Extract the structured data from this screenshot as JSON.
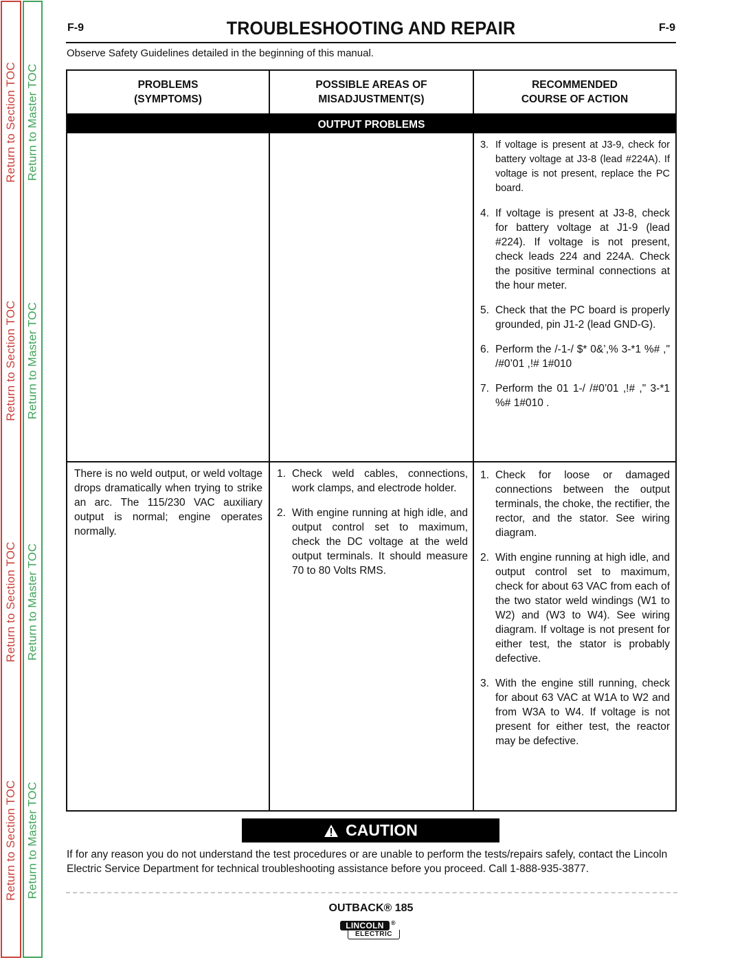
{
  "sidebar": {
    "section_toc_label": "Return to Section TOC",
    "master_toc_label": "Return to Master TOC",
    "colors": {
      "section": "#c8413b",
      "master": "#3fa45b"
    }
  },
  "header": {
    "page_code_left": "F-9",
    "page_code_right": "F-9",
    "title": "TROUBLESHOOTING AND REPAIR",
    "safety_note": "Observe Safety Guidelines detailed in the beginning of this manual."
  },
  "table": {
    "columns": [
      {
        "line1": "PROBLEMS",
        "line2": "(SYMPTOMS)"
      },
      {
        "line1": "POSSIBLE AREAS OF",
        "line2": "MISADJUSTMENT(S)"
      },
      {
        "line1": "RECOMMENDED",
        "line2": "COURSE OF ACTION"
      }
    ],
    "section_band": "OUTPUT PROBLEMS",
    "rows": [
      {
        "symptom": "",
        "misadjustments": [],
        "actions": [
          {
            "num": "3.",
            "text": "If voltage is present at J3-9, check for battery voltage at J3-8 (lead #224A).  If voltage is not present, replace the PC board."
          },
          {
            "num": "4.",
            "text": "If voltage is present at J3-8, check for battery voltage at J1-9 (lead #224).  If voltage is not present, check leads 224 and 224A.  Check the positive terminal connections at the hour meter."
          },
          {
            "num": "5.",
            "text": "Check that the PC board is properly grounded, pin J1-2 (lead GND-G)."
          },
          {
            "num": "6.",
            "text": "Perform the /-1-/ $* 0&’,% 3-*1 %#     ,\"   /#0’01 ,!# 1#010"
          },
          {
            "num": "7.",
            "text": "Perform the 01 1-/ /#0’01 ,!# ,\" 3-*1 %# 1#010 ."
          }
        ]
      },
      {
        "symptom": "There is no weld output, or weld voltage drops dramatically when trying to strike an arc.  The 115/230 VAC auxiliary output is normal;  engine  operates normally.",
        "misadjustments": [
          {
            "num": "1.",
            "text": "Check weld cables, connections, work clamps, and electrode holder."
          },
          {
            "num": "2.",
            "text": "With engine running at high idle, and output control set to maximum, check the DC voltage at the weld output terminals.  It should measure 70 to 80 Volts RMS."
          }
        ],
        "actions": [
          {
            "num": "1.",
            "text": "Check for loose or damaged connections between the output terminals, the choke, the rectifier, the rector, and the stator.  See wiring diagram."
          },
          {
            "num": "2.",
            "text": "With engine running at high idle, and output control set to maximum, check for about 63 VAC from each of the two stator weld windings (W1 to W2) and (W3 to W4).  See wiring diagram.  If voltage is not present for either test, the stator is probably defective."
          },
          {
            "num": "3.",
            "text": "With the engine still running, check for about 63 VAC at W1A to W2 and from W3A to W4.  If voltage is not present for either test, the reactor may be defective."
          }
        ]
      }
    ]
  },
  "caution": {
    "icon": "warning-triangle-icon",
    "label": "CAUTION",
    "text": "If for any reason you do not understand the test procedures or are unable to perform the tests/repairs safely, contact the Lincoln Electric Service Department for technical troubleshooting assistance before you proceed. Call 1-888-935-3877."
  },
  "footer": {
    "product": "OUTBACK® 185",
    "logo_top": "LINCOLN",
    "logo_reg": "®",
    "logo_bottom": "ELECTRIC"
  }
}
